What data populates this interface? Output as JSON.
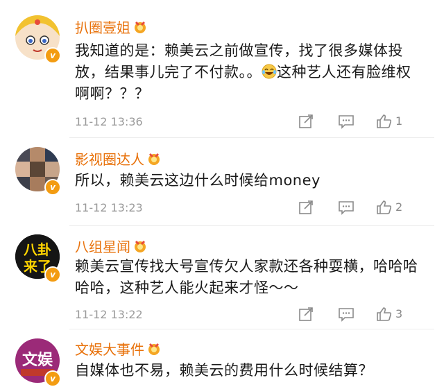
{
  "comments": [
    {
      "username": "扒圈壹姐",
      "text_before_emoji": "我知道的是：赖美云之前做宣传，找了很多媒体投放，结果事儿完了不付款。。",
      "text_after_emoji": "这种艺人还有脸维权啊啊？？？",
      "emoji": "laughing-tears-emoji",
      "timestamp": "11-12 13:36",
      "likes": "1"
    },
    {
      "username": "影视圈达人",
      "text_before_emoji": "所以，赖美云这边什么时候给money",
      "timestamp": "11-12 13:23",
      "likes": "2"
    },
    {
      "username": "八组星闻",
      "avatar_text": "八卦来了",
      "text_before_emoji": "赖美云宣传找大号宣传欠人家款还各种耍横，哈哈哈哈哈，这种艺人能火起来才怪～～",
      "timestamp": "11-12 13:22",
      "likes": "3"
    },
    {
      "username": "文娱大事件",
      "avatar_text": "文娱",
      "text_before_emoji": "自媒体也不易，赖美云的费用什么时候结算？"
    }
  ],
  "colors": {
    "username": "#e8710a",
    "badge": "#f39c12",
    "meta": "#9a9a9a"
  },
  "icons": [
    "share-icon",
    "comment-icon",
    "like-icon",
    "verified-badge-icon",
    "medal-icon"
  ]
}
